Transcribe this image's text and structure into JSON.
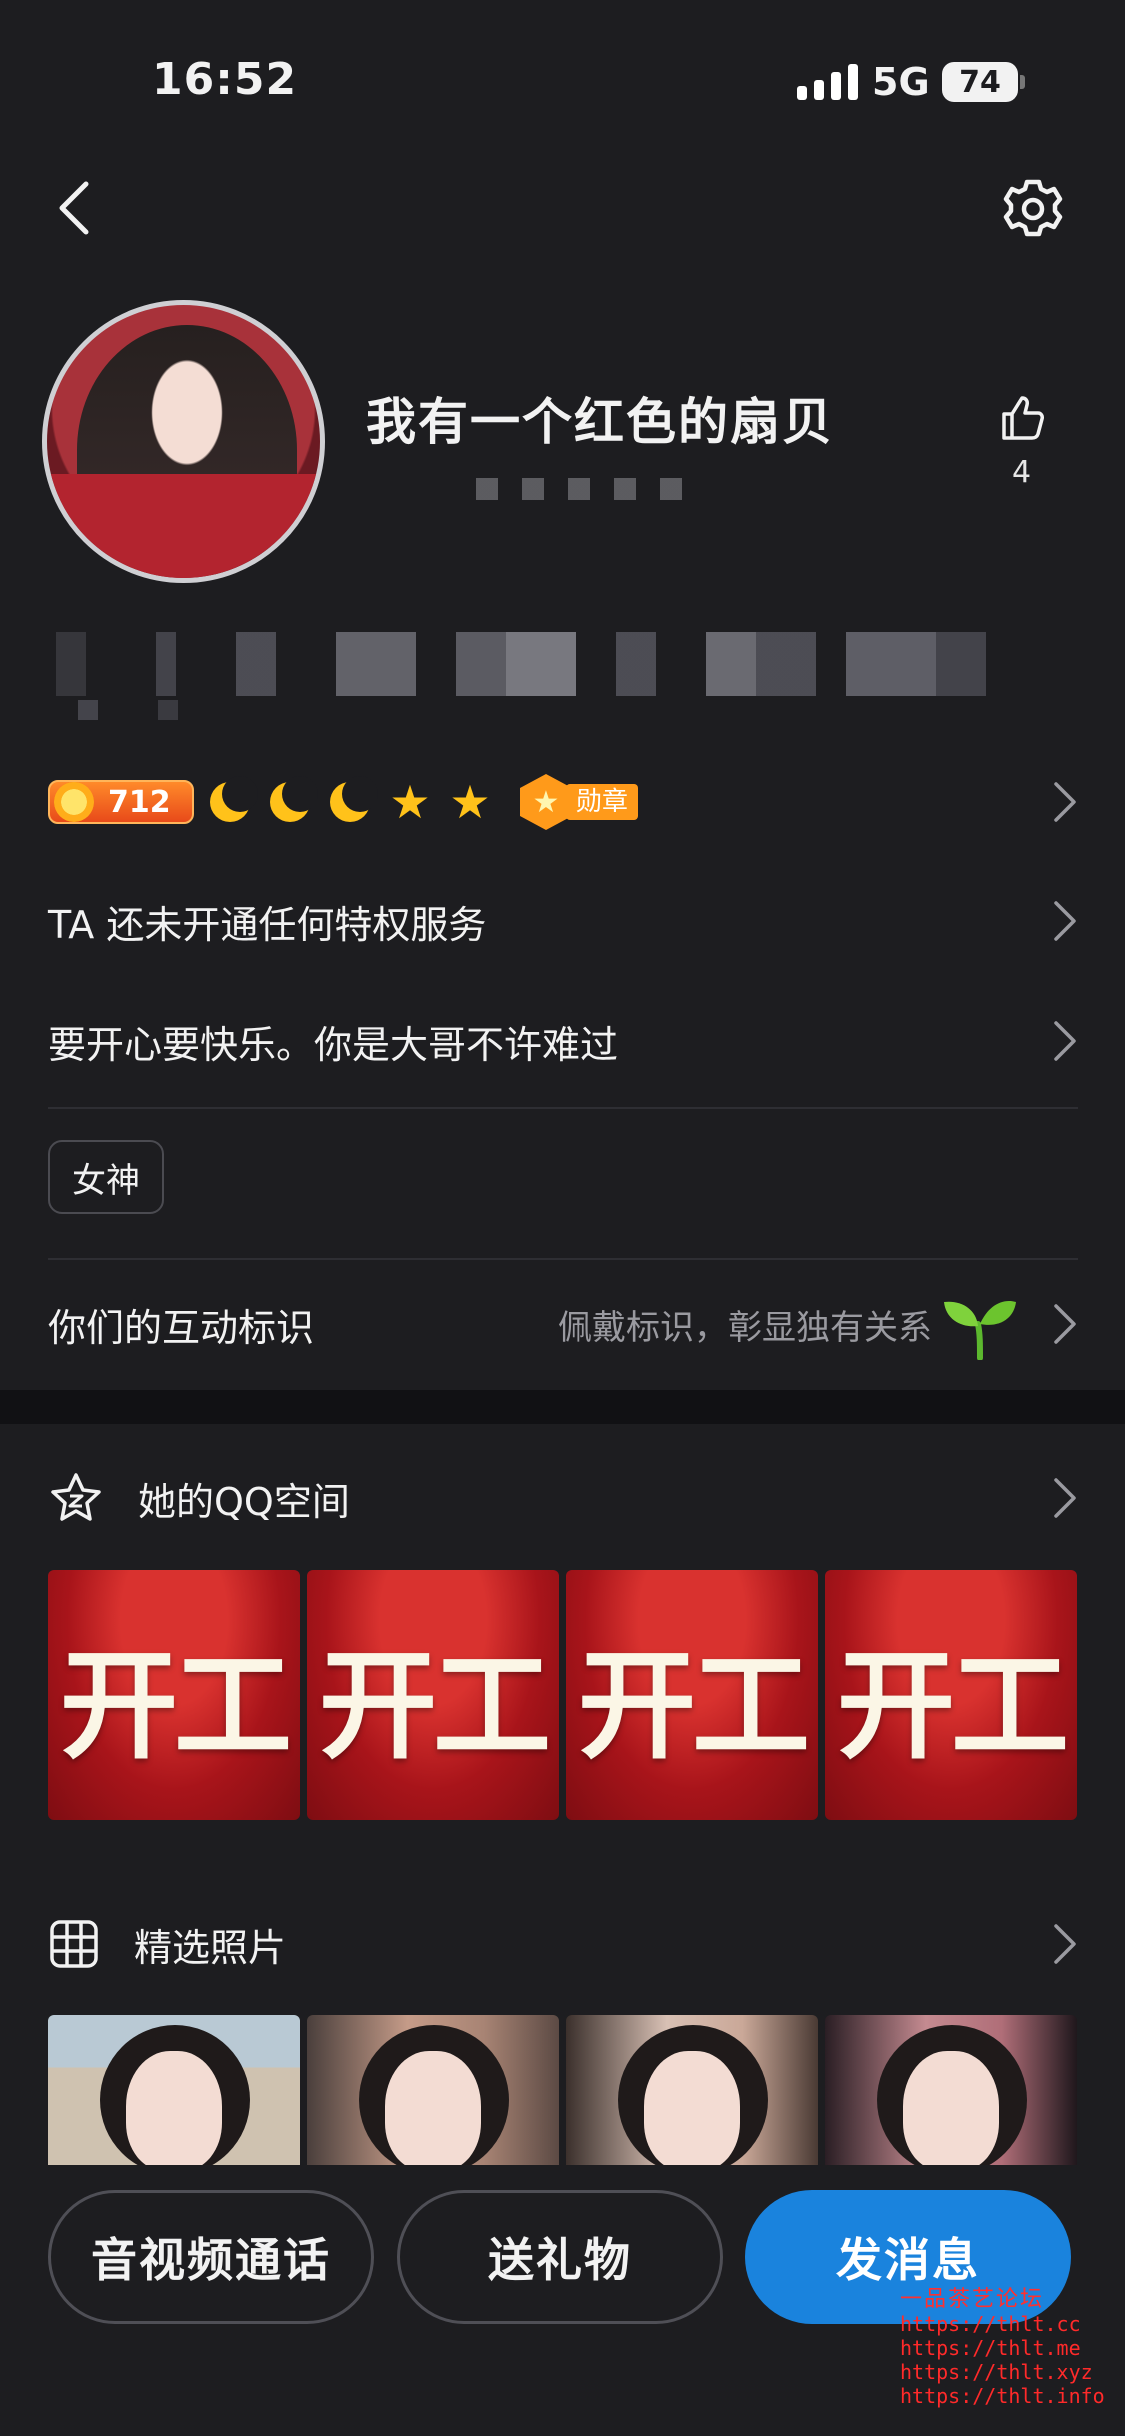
{
  "status_bar": {
    "time": "16:52",
    "network": "5G",
    "battery": "74"
  },
  "profile": {
    "nickname": "我有一个红色的扇贝",
    "likes": "4"
  },
  "badges": {
    "level": "712",
    "medal_label": "勋章"
  },
  "rows": {
    "privilege": "TA 还未开通任何特权服务",
    "signature": "要开心要快乐。你是大哥不许难过",
    "tag": "女神",
    "interaction_label": "你们的互动标识",
    "interaction_hint": "佩戴标识，彰显独有关系"
  },
  "qzone": {
    "title": "她的QQ空间",
    "posts": [
      {
        "text": "开工"
      },
      {
        "text": "开工"
      },
      {
        "text": "开工"
      },
      {
        "text": "开工"
      }
    ]
  },
  "photos": {
    "title": "精选照片"
  },
  "actions": {
    "call": "音视频通话",
    "gift": "送礼物",
    "message": "发消息"
  },
  "watermark": {
    "title": "一品茶艺论坛",
    "lines": [
      "https://thlt.cc",
      "https://thlt.me",
      "https://thlt.xyz",
      "https://thlt.info"
    ]
  },
  "colors": {
    "accent": "#1a83dd",
    "background": "#1d1d20"
  }
}
